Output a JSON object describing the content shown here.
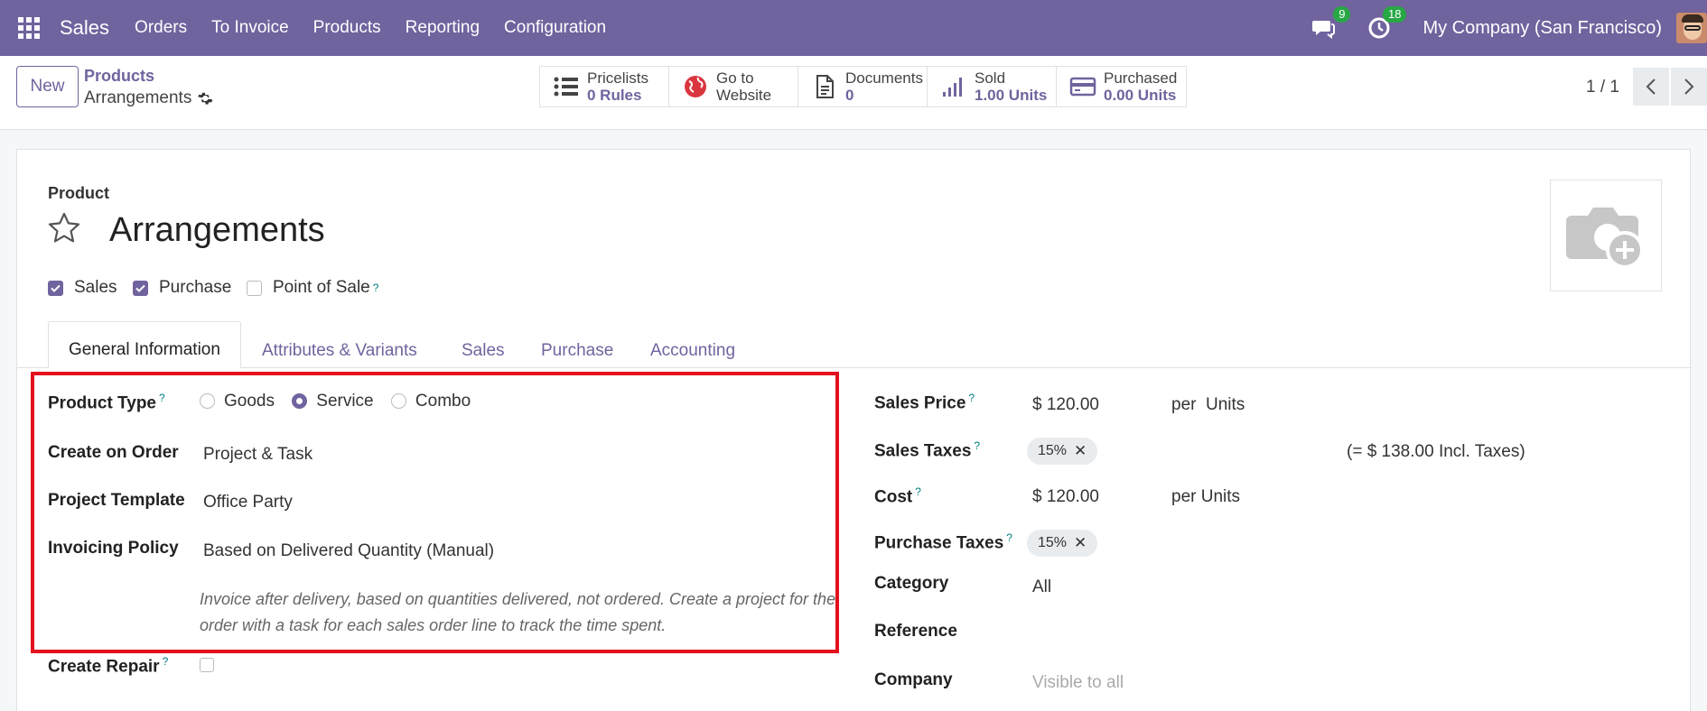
{
  "topbar": {
    "app_name": "Sales",
    "menu": [
      "Orders",
      "To Invoice",
      "Products",
      "Reporting",
      "Configuration"
    ],
    "messages_count": "9",
    "activities_count": "18",
    "company": "My Company (San Francisco)",
    "bg_color": "#71639e"
  },
  "control": {
    "new_label": "New",
    "breadcrumb_parent": "Products",
    "breadcrumb_current": "Arrangements",
    "smart_buttons": [
      {
        "label": "Pricelists",
        "value": "0 Rules",
        "icon": "list-icon"
      },
      {
        "label": "Go to",
        "value": "Website",
        "icon": "globe-icon"
      },
      {
        "label": "Documents",
        "value": "0",
        "icon": "document-icon"
      },
      {
        "label": "Sold",
        "value": "1.00 Units",
        "icon": "chart-icon"
      },
      {
        "label": "Purchased",
        "value": "0.00 Units",
        "icon": "credit-card-icon"
      }
    ],
    "pager": "1 / 1"
  },
  "product": {
    "type_label": "Product",
    "name": "Arrangements",
    "checks": [
      {
        "label": "Sales",
        "checked": true
      },
      {
        "label": "Purchase",
        "checked": true
      },
      {
        "label": "Point of Sale",
        "checked": false
      }
    ],
    "help_mark": "?"
  },
  "tabs": [
    "General Information",
    "Attributes & Variants",
    "Sales",
    "Purchase",
    "Accounting"
  ],
  "left_fields": {
    "product_type_label": "Product Type",
    "product_type_options": [
      "Goods",
      "Service",
      "Combo"
    ],
    "product_type_selected": "Service",
    "create_on_order_label": "Create on Order",
    "create_on_order_value": "Project & Task",
    "project_template_label": "Project Template",
    "project_template_value": "Office Party",
    "invoicing_policy_label": "Invoicing Policy",
    "invoicing_policy_value": "Based on Delivered Quantity (Manual)",
    "invoicing_help": "Invoice after delivery, based on quantities delivered, not ordered. Create a project for the order with a task for each sales order line to track the time spent.",
    "create_repair_label": "Create Repair"
  },
  "right_fields": {
    "sales_price_label": "Sales Price",
    "sales_price_value": "$ 120.00",
    "sales_price_unit": "per  Units",
    "sales_taxes_label": "Sales Taxes",
    "sales_tax_tag": "15%",
    "incl_taxes": "(= $ 138.00 Incl. Taxes)",
    "cost_label": "Cost",
    "cost_value": "$ 120.00",
    "cost_unit": "per Units",
    "purchase_taxes_label": "Purchase Taxes",
    "purchase_tax_tag": "15%",
    "category_label": "Category",
    "category_value": "All",
    "reference_label": "Reference",
    "company_label": "Company",
    "company_placeholder": "Visible to all"
  }
}
